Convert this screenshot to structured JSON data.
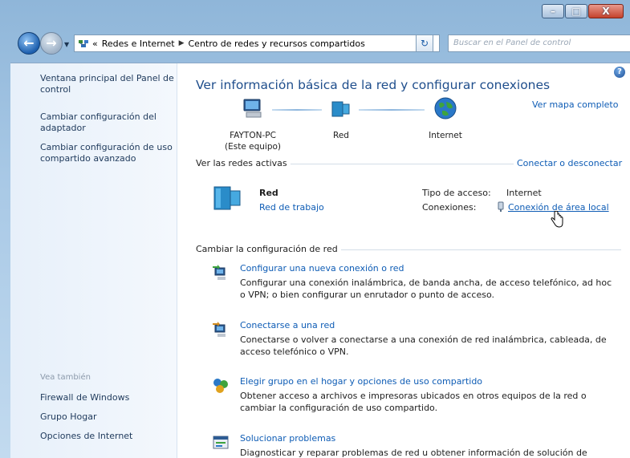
{
  "window": {
    "minimize_label": "–",
    "maximize_label": "□",
    "close_label": "X"
  },
  "address": {
    "breadcrumb": [
      "Redes e Internet",
      "Centro de redes y recursos compartidos"
    ],
    "overflow_label": "«",
    "search_placeholder": "Buscar en el Panel de control"
  },
  "sidebar": {
    "links": [
      "Ventana principal del Panel de control",
      "Cambiar configuración del adaptador",
      "Cambiar configuración de uso compartido avanzado"
    ],
    "see_also_label": "Vea también",
    "see_also": [
      "Firewall de Windows",
      "Grupo Hogar",
      "Opciones de Internet"
    ]
  },
  "main": {
    "title": "Ver información básica de la red y configurar conexiones",
    "view_full_map": "Ver mapa completo",
    "map": {
      "computer_name": "FAYTON-PC",
      "computer_sub": "(Este equipo)",
      "network": "Red",
      "internet": "Internet"
    },
    "active_networks": {
      "label": "Ver las redes activas",
      "connect_link": "Conectar o desconectar",
      "network_name": "Red",
      "network_type": "Red de trabajo",
      "access_type_label": "Tipo de acceso:",
      "access_type_value": "Internet",
      "connections_label": "Conexiones:",
      "connections_value": "Conexión de área local"
    },
    "change_settings_label": "Cambiar la configuración de red",
    "tasks": [
      {
        "title": "Configurar una nueva conexión o red",
        "desc": "Configurar una conexión inalámbrica, de banda ancha, de acceso telefónico, ad hoc o VPN; o bien configurar un enrutador o punto de acceso."
      },
      {
        "title": "Conectarse a una red",
        "desc": "Conectarse o volver a conectarse a una conexión de red inalámbrica, cableada, de acceso telefónico o VPN."
      },
      {
        "title": "Elegir grupo en el hogar y opciones de uso compartido",
        "desc": "Obtener acceso a archivos e impresoras ubicados en otros equipos de la red o cambiar la configuración de uso compartido."
      },
      {
        "title": "Solucionar problemas",
        "desc": "Diagnosticar y reparar problemas de red u obtener información de solución de"
      }
    ]
  },
  "colors": {
    "link": "#0e5cb5",
    "title": "#1f4e8c",
    "sidebar_link": "#1e395b"
  }
}
